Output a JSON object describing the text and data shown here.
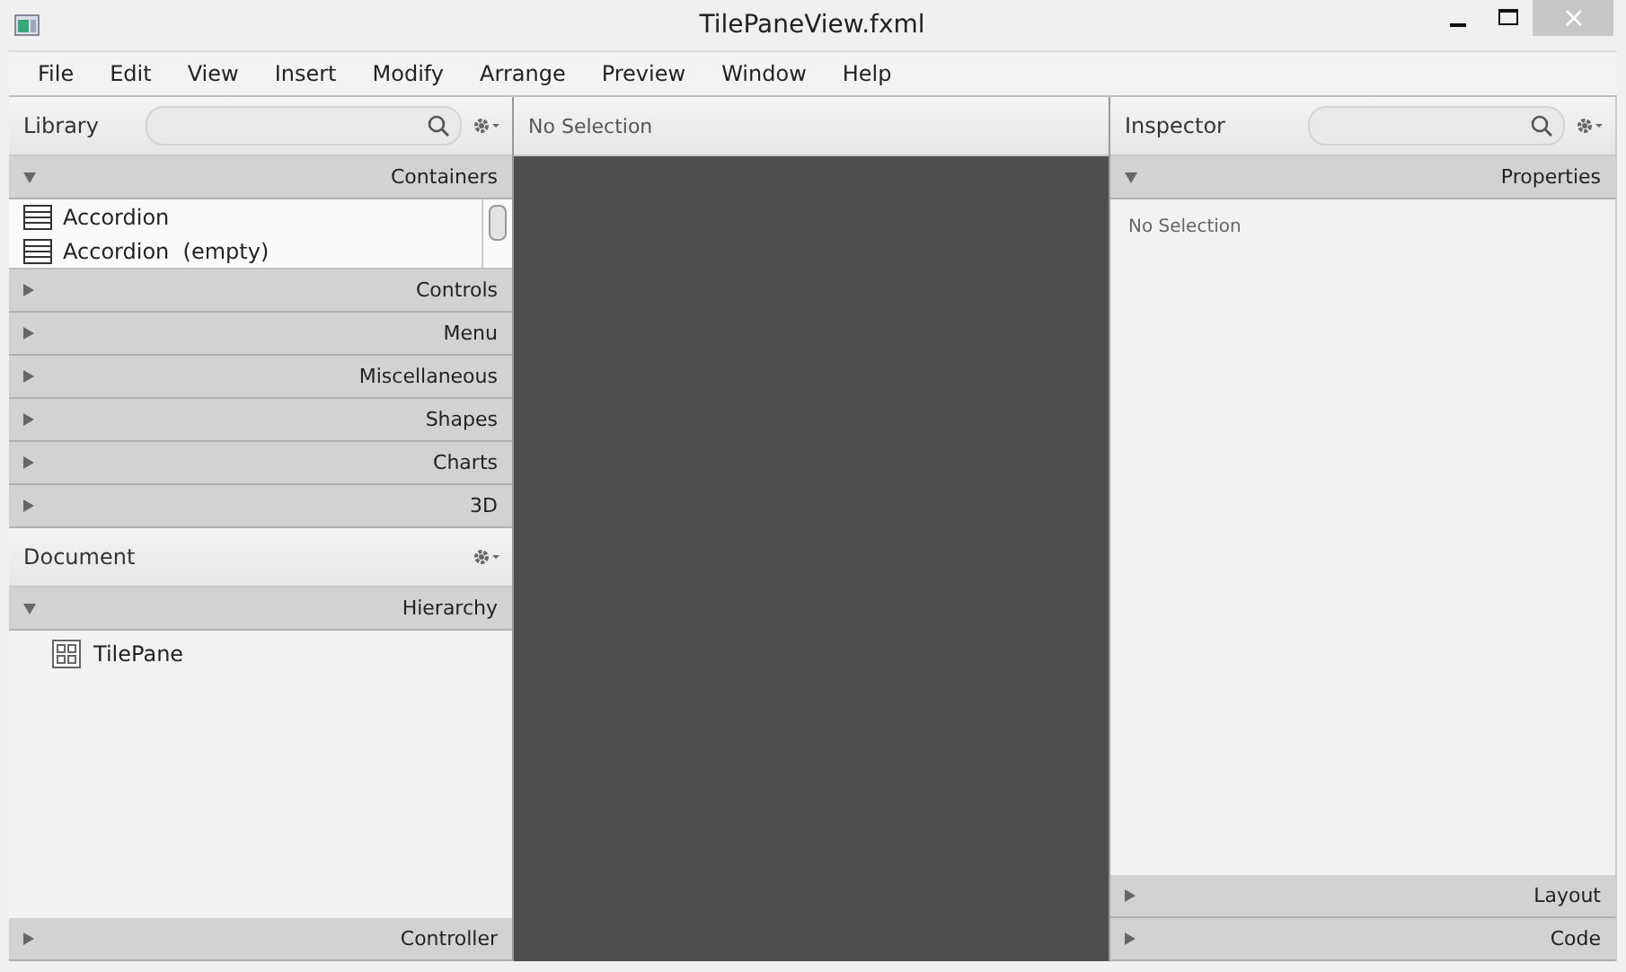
{
  "window": {
    "title": "TilePaneView.fxml"
  },
  "menu": [
    "File",
    "Edit",
    "View",
    "Insert",
    "Modify",
    "Arrange",
    "Preview",
    "Window",
    "Help"
  ],
  "library": {
    "title": "Library",
    "panes": [
      {
        "title": "Containers",
        "expanded": true,
        "items": [
          "Accordion",
          "Accordion  (empty)"
        ]
      },
      {
        "title": "Controls",
        "expanded": false
      },
      {
        "title": "Menu",
        "expanded": false
      },
      {
        "title": "Miscellaneous",
        "expanded": false
      },
      {
        "title": "Shapes",
        "expanded": false
      },
      {
        "title": "Charts",
        "expanded": false
      },
      {
        "title": "3D",
        "expanded": false
      }
    ]
  },
  "document": {
    "title": "Document",
    "panes": [
      {
        "title": "Hierarchy",
        "expanded": true,
        "tree": [
          {
            "label": "TilePane"
          }
        ]
      },
      {
        "title": "Controller",
        "expanded": false
      }
    ]
  },
  "canvas": {
    "header": "No Selection"
  },
  "inspector": {
    "title": "Inspector",
    "panes": [
      {
        "title": "Properties",
        "expanded": true,
        "message": "No Selection"
      },
      {
        "title": "Layout",
        "expanded": false
      },
      {
        "title": "Code",
        "expanded": false
      }
    ]
  }
}
